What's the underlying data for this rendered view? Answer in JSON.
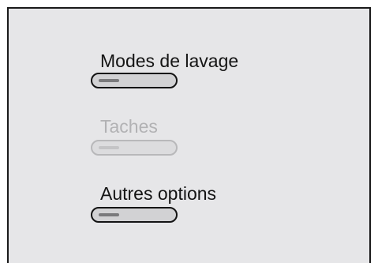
{
  "menu": {
    "items": [
      {
        "label": "Modes de lavage",
        "enabled": true
      },
      {
        "label": "Taches",
        "enabled": false
      },
      {
        "label": "Autres options",
        "enabled": true
      }
    ]
  },
  "colors": {
    "screen_background": "#e6e6e8",
    "text": "#141414",
    "disabled_text": "#b2b2b4",
    "frame": "#1a1a1a"
  }
}
